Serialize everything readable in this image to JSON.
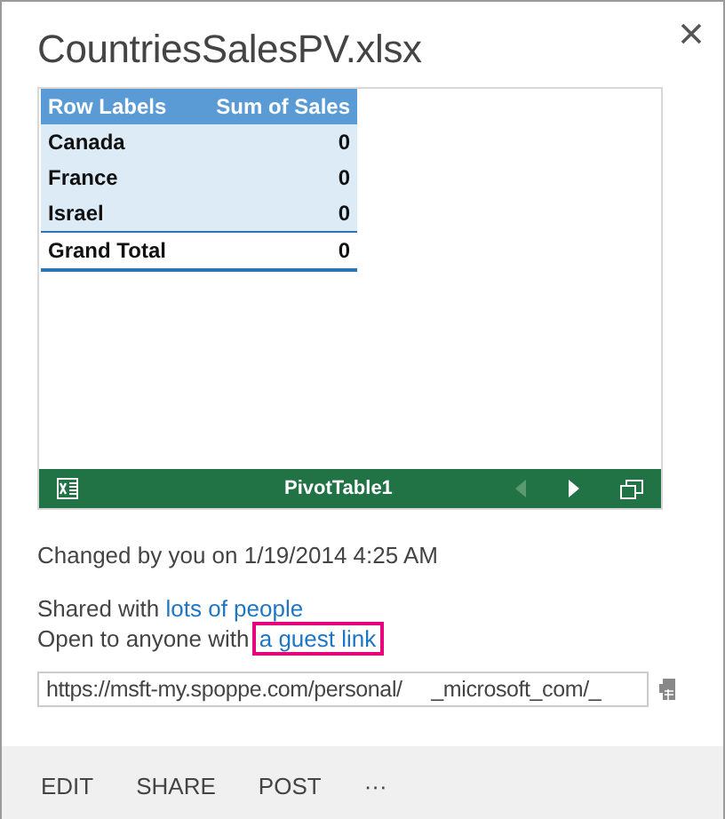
{
  "title": "CountriesSalesPV.xlsx",
  "pivot": {
    "columns": [
      "Row Labels",
      "Sum of Sales"
    ],
    "rows": [
      {
        "label": "Canada",
        "value": "0",
        "kind": "item"
      },
      {
        "label": "France",
        "value": "0",
        "kind": "item"
      },
      {
        "label": "Israel",
        "value": "0",
        "kind": "item"
      },
      {
        "label": "Grand Total",
        "value": "0",
        "kind": "total"
      }
    ],
    "bar_title": "PivotTable1"
  },
  "changed": "Changed by you on 1/19/2014 4:25 AM",
  "shared": {
    "text": "Shared with ",
    "link": "lots of people"
  },
  "guest": {
    "text": "Open to anyone with ",
    "link": "a guest link",
    "highlighted": true
  },
  "url": "https://msft-my.spoppe.com/personal/     _microsoft_com/_",
  "actions": [
    "EDIT",
    "SHARE",
    "POST",
    "···"
  ]
}
